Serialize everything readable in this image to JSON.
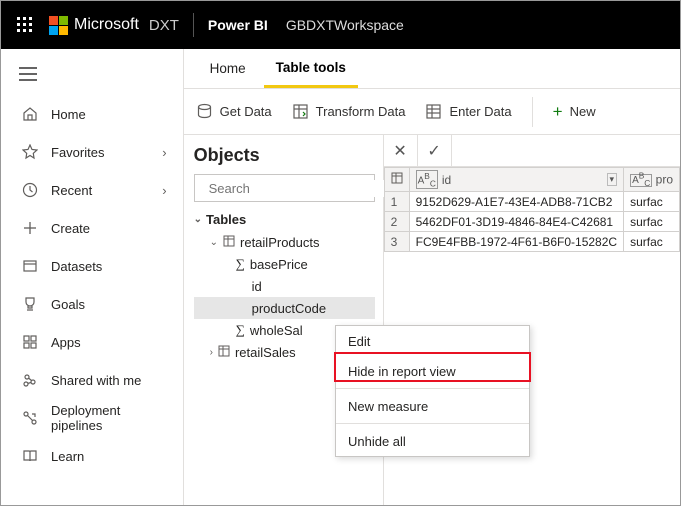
{
  "topbar": {
    "brand": "Microsoft",
    "dxt": "DXT",
    "product": "Power BI",
    "workspace": "GBDXTWorkspace"
  },
  "sidebar": {
    "items": [
      {
        "label": "Home",
        "icon": "home",
        "chev": false
      },
      {
        "label": "Favorites",
        "icon": "star",
        "chev": true
      },
      {
        "label": "Recent",
        "icon": "clock",
        "chev": true
      },
      {
        "label": "Create",
        "icon": "plus",
        "chev": false
      },
      {
        "label": "Datasets",
        "icon": "box",
        "chev": false
      },
      {
        "label": "Goals",
        "icon": "trophy",
        "chev": false
      },
      {
        "label": "Apps",
        "icon": "apps",
        "chev": false
      },
      {
        "label": "Shared with me",
        "icon": "share",
        "chev": false
      },
      {
        "label": "Deployment pipelines",
        "icon": "pipeline",
        "chev": false
      },
      {
        "label": "Learn",
        "icon": "book",
        "chev": false
      }
    ]
  },
  "tabs": {
    "home": "Home",
    "table_tools": "Table tools"
  },
  "ribbon": {
    "get_data": "Get Data",
    "transform": "Transform Data",
    "enter": "Enter Data",
    "new": "New"
  },
  "objects": {
    "title": "Objects",
    "search_placeholder": "Search",
    "tables_label": "Tables",
    "tree": {
      "retailProducts": "retailProducts",
      "basePrice": "basePrice",
      "id": "id",
      "productCode": "productCode",
      "wholeSale": "wholeSal",
      "retailSales": "retailSales"
    }
  },
  "grid": {
    "col_id": "id",
    "col_pr": "pro",
    "abc": "ABC",
    "rows": [
      {
        "n": "1",
        "id": "9152D629-A1E7-43E4-ADB8-71CB2",
        "p": "surfac"
      },
      {
        "n": "2",
        "id": "5462DF01-3D19-4846-84E4-C42681",
        "p": "surfac"
      },
      {
        "n": "3",
        "id": "FC9E4FBB-1972-4F61-B6F0-15282C",
        "p": "surfac"
      }
    ]
  },
  "context_menu": {
    "edit": "Edit",
    "hide": "Hide in report view",
    "new_measure": "New measure",
    "unhide": "Unhide all"
  }
}
